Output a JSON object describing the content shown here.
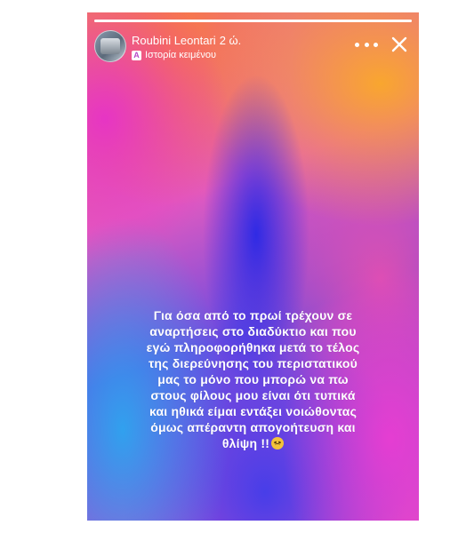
{
  "story": {
    "progress": 1.0,
    "user_name": "Roubini Leontari",
    "time": "2 ώ.",
    "subtitle_icon": "text-story-icon",
    "subtitle_icon_letter": "A",
    "subtitle": "Ιστορία κειμένου",
    "text_lines": [
      "Για όσα από το πρωί τρέχουν σε",
      "αναρτήσεις στο διαδύκτιο  και που",
      "εγώ πληροφορήθηκα μετά το τέλος",
      "της διερεύνησης του περιστατικού",
      "μας το μόνο που μπορώ να πω",
      "στους φίλους μου είναι ότι τυπικά",
      "και ηθικά είμαι εντάξει  νοιώθοντας",
      "όμως απέραντη απογοήτευση και",
      "θλίψη !!"
    ],
    "end_emoji": "disappointed-face-emoji"
  },
  "colors": {
    "text": "#ffffff",
    "gradient_pink": "#e25ac0",
    "gradient_blue": "#3a3ae6",
    "gradient_orange": "#faaa28"
  }
}
